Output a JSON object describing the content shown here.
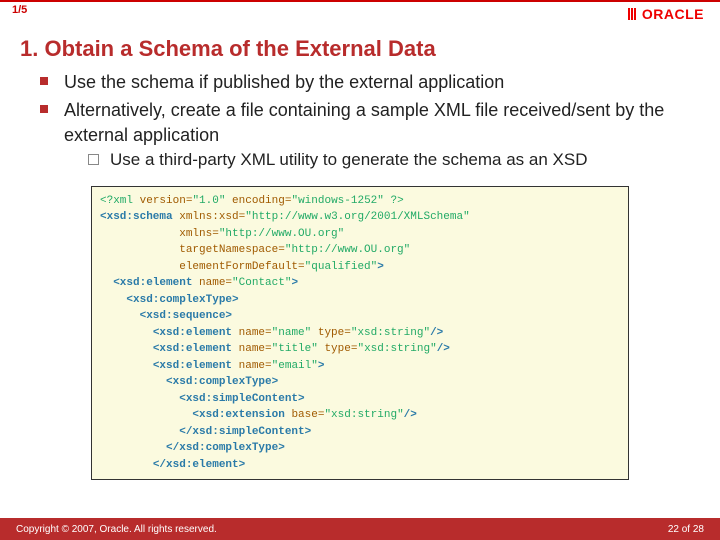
{
  "topbar": {
    "indicator": "1/5",
    "logo_text": "ORACLE"
  },
  "title": "1. Obtain a Schema of the External Data",
  "bullets": [
    {
      "text": "Use the schema if published by the external application"
    },
    {
      "text": "Alternatively, create a file containing a sample XML file received/sent by the external application",
      "sub": [
        {
          "text": "Use a third-party XML utility to generate the schema as an XSD"
        }
      ]
    }
  ],
  "code": {
    "l1_a": "<?xml",
    "l1_b": " version=",
    "l1_c": "\"1.0\"",
    "l1_d": " encoding=",
    "l1_e": "\"windows-1252\"",
    "l1_f": " ?>",
    "l2_a": "<xsd:schema",
    "l2_b": " xmlns:xsd=",
    "l2_c": "\"http://www.w3.org/2001/XMLSchema\"",
    "l3_b": "xmlns=",
    "l3_c": "\"http://www.OU.org\"",
    "l4_b": "targetNamespace=",
    "l4_c": "\"http://www.OU.org\"",
    "l5_b": "elementFormDefault=",
    "l5_c": "\"qualified\"",
    "l5_f": ">",
    "l6_a": "<xsd:element",
    "l6_b": " name=",
    "l6_c": "\"Contact\"",
    "l6_f": ">",
    "l7_a": "<xsd:complexType>",
    "l8_a": "<xsd:sequence>",
    "l9_a": "<xsd:element",
    "l9_b": " name=",
    "l9_c": "\"name\"",
    "l9_d": " type=",
    "l9_e": "\"xsd:string\"",
    "l9_f": "/>",
    "l10_a": "<xsd:element",
    "l10_b": " name=",
    "l10_c": "\"title\"",
    "l10_d": " type=",
    "l10_e": "\"xsd:string\"",
    "l10_f": "/>",
    "l11_a": "<xsd:element",
    "l11_b": " name=",
    "l11_c": "\"email\"",
    "l11_f": ">",
    "l12_a": "<xsd:complexType>",
    "l13_a": "<xsd:simpleContent>",
    "l14_a": "<xsd:extension",
    "l14_b": " base=",
    "l14_c": "\"xsd:string\"",
    "l14_f": "/>",
    "l15_a": "</xsd:simpleContent>",
    "l16_a": "</xsd:complexType>",
    "l17_a": "</xsd:element>"
  },
  "footer": {
    "copyright": "Copyright © 2007, Oracle. All rights reserved.",
    "page_current": "22",
    "page_sep": " of ",
    "page_total": "28"
  }
}
